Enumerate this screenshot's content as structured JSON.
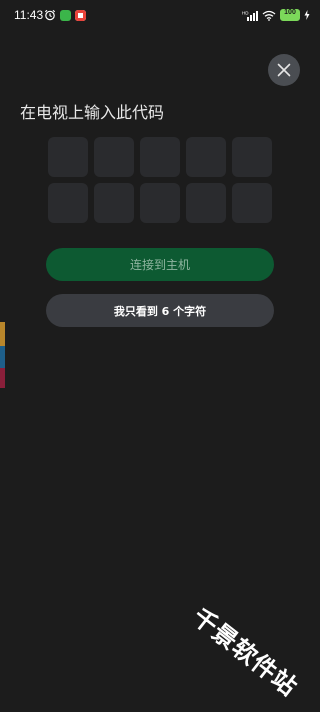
{
  "status_bar": {
    "time": "11:43",
    "battery_level": "100",
    "signal_label": "HD",
    "colors": {
      "app_badge_green": "#3bb54a",
      "app_badge_red": "#e8433a",
      "battery": "#7cd85a"
    }
  },
  "close_button": {
    "icon": "close-icon"
  },
  "title": "在电视上输入此代码",
  "code_cells": [
    "",
    "",
    "",
    "",
    "",
    "",
    "",
    "",
    "",
    ""
  ],
  "buttons": {
    "connect_label": "连接到主机",
    "six_char_label": "我只看到 6 个字符"
  },
  "watermark": "千景软件站",
  "colors": {
    "background": "#1c1c1c",
    "cell": "#2a2b2e",
    "primary_button": "#0d5a32",
    "primary_text": "#8fb5a0",
    "secondary_button": "#3a3c41",
    "edge_strip": [
      "#b8862b",
      "#1e5f8a",
      "#8a1f3a"
    ]
  }
}
